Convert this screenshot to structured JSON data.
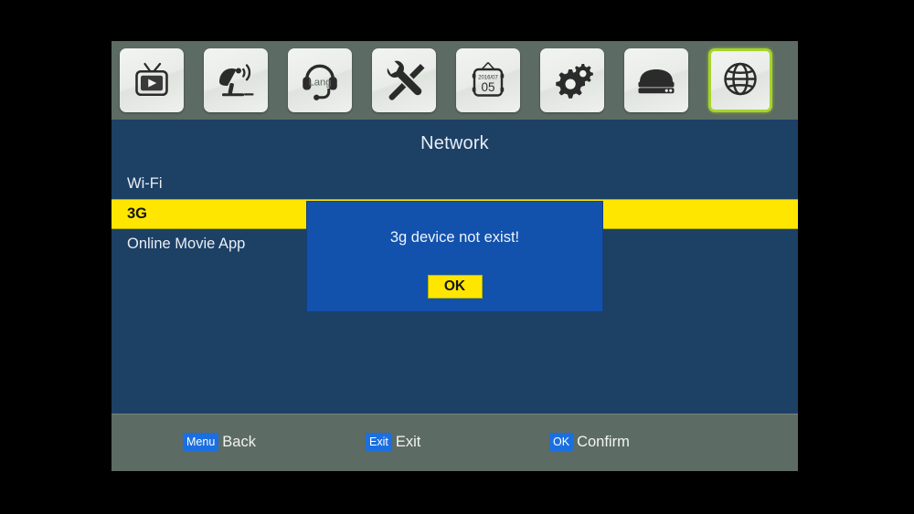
{
  "screen": {
    "background_color": "#1d4065",
    "frame_color": "#000000"
  },
  "toolbar": {
    "background_color": "#5c6b63",
    "selected_border_color": "#a6d42a",
    "items": [
      {
        "id": "tv",
        "icon": "tv-icon",
        "label": "TV"
      },
      {
        "id": "installation",
        "icon": "satellite-dish-icon",
        "label": "Installation"
      },
      {
        "id": "language",
        "icon": "headset-lang-icon",
        "label": "Lang",
        "badge": "Lang"
      },
      {
        "id": "tools",
        "icon": "wrench-screwdriver-icon",
        "label": "Tools"
      },
      {
        "id": "date",
        "icon": "calendar-icon",
        "label": "Date",
        "calendar_month": "2016/07",
        "calendar_day": "05"
      },
      {
        "id": "settings",
        "icon": "gears-icon",
        "label": "Settings"
      },
      {
        "id": "storage",
        "icon": "hard-drive-icon",
        "label": "Storage"
      },
      {
        "id": "network",
        "icon": "globe-icon",
        "label": "Network",
        "selected": true
      }
    ]
  },
  "header": {
    "title": "Network"
  },
  "menu": {
    "highlight_color": "#ffe600",
    "items": [
      {
        "label": "Wi-Fi",
        "selected": false
      },
      {
        "label": "3G",
        "selected": true
      },
      {
        "label": "Online Movie App",
        "selected": false
      }
    ]
  },
  "dialog": {
    "visible": true,
    "message": "3g device not exist!",
    "ok_label": "OK",
    "background_color": "#1252ad",
    "button_color": "#ffe600"
  },
  "hint_bar": {
    "background_color": "#5c6b63",
    "key_badge_color": "#1b6fe0",
    "hints": [
      {
        "key": "Menu",
        "text": "Back"
      },
      {
        "key": "Exit",
        "text": "Exit"
      },
      {
        "key": "OK",
        "text": "Confirm"
      }
    ]
  }
}
